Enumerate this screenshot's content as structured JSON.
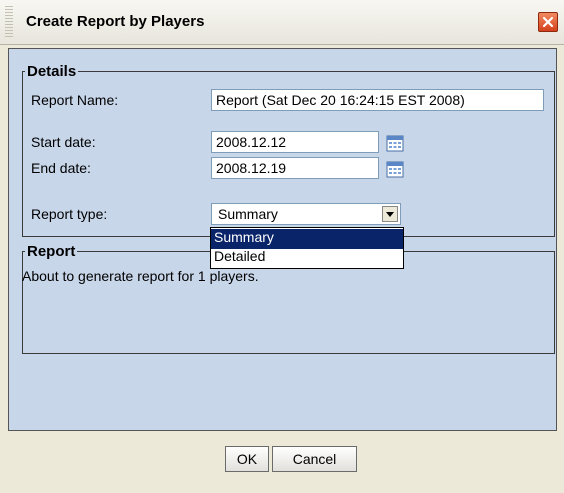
{
  "dialog": {
    "title": "Create Report by Players"
  },
  "details": {
    "legend": "Details",
    "report_name_label": "Report Name:",
    "report_name_value": "Report (Sat Dec 20 16:24:15 EST 2008)",
    "start_date_label": "Start date:",
    "start_date_value": "2008.12.12",
    "end_date_label": "End date:",
    "end_date_value": "2008.12.19",
    "report_type_label": "Report type:",
    "report_type_value": "Summary",
    "report_type_options": [
      "Summary",
      "Detailed"
    ],
    "calendar_icon": "calendar-icon"
  },
  "report": {
    "legend": "Report",
    "message": "About to generate report for 1 players."
  },
  "buttons": {
    "ok_label": "OK",
    "cancel_label": "Cancel"
  },
  "colors": {
    "panel_bg": "#c8d6ea",
    "selection_bg": "#0a246a",
    "close_button": "#d4421b"
  }
}
